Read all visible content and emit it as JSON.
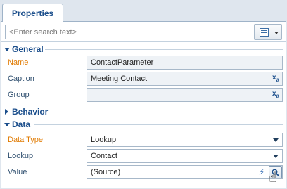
{
  "tab": {
    "label": "Properties"
  },
  "search": {
    "placeholder": "<Enter search text>"
  },
  "groups": {
    "general": {
      "title": "General",
      "rows": [
        {
          "label": "Name",
          "value": "ContactParameter"
        },
        {
          "label": "Caption",
          "value": "Meeting Contact"
        },
        {
          "label": "Group",
          "value": ""
        }
      ]
    },
    "behavior": {
      "title": "Behavior"
    },
    "data": {
      "title": "Data",
      "rows": [
        {
          "label": "Data Type",
          "value": "Lookup"
        },
        {
          "label": "Lookup",
          "value": "Contact"
        },
        {
          "label": "Value",
          "value": "(Source)"
        }
      ]
    }
  },
  "icons": {
    "view_menu": "grid-list-icon",
    "translate": "translate-icon",
    "dropdown": "chevron-down-icon",
    "formula": "lightning-icon",
    "lookup": "search-icon",
    "cursor": "hand-pointer-icon"
  },
  "colors": {
    "accent": "#1c4f8c",
    "required_label": "#e07a00",
    "border": "#9fb3c8",
    "readonly_bg": "#eef2f6"
  }
}
